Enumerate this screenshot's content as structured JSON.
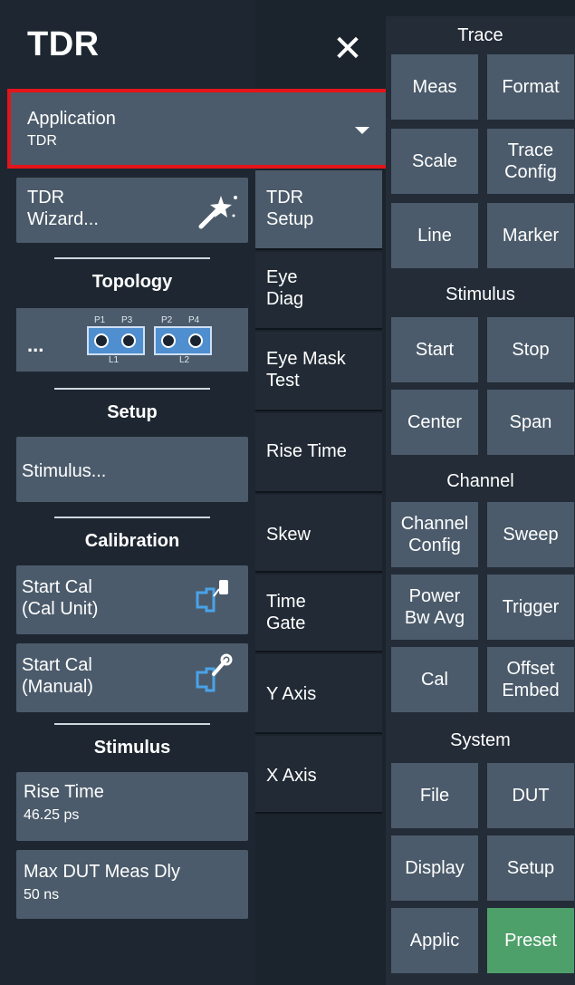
{
  "dialog": {
    "title": "TDR",
    "close_symbol": "✕"
  },
  "application": {
    "label": "Application",
    "value": "TDR"
  },
  "left": {
    "wizard": {
      "label_line1": "TDR",
      "label_line2": "Wizard..."
    },
    "topology": {
      "heading": "Topology",
      "button_text": "...",
      "ports": [
        "P1",
        "P3",
        "P2",
        "P4"
      ],
      "lines": [
        "L1",
        "L2"
      ]
    },
    "setup": {
      "heading": "Setup",
      "stimulus_button": "Stimulus..."
    },
    "calibration": {
      "heading": "Calibration",
      "start_cal_unit": {
        "line1": "Start Cal",
        "line2": "(Cal Unit)"
      },
      "start_cal_manual": {
        "line1": "Start Cal",
        "line2": "(Manual)"
      }
    },
    "stimulus": {
      "heading": "Stimulus",
      "rise_time": {
        "label": "Rise Time",
        "value": "46.25 ps"
      },
      "max_dut_meas_dly": {
        "label": "Max DUT Meas Dly",
        "value": "50 ns"
      }
    }
  },
  "tabs": [
    {
      "line1": "TDR",
      "line2": "Setup",
      "active": true
    },
    {
      "line1": "Eye",
      "line2": "Diag"
    },
    {
      "line1": "Eye Mask",
      "line2": "Test"
    },
    {
      "line1": "Rise Time",
      "line2": ""
    },
    {
      "line1": "Skew",
      "line2": ""
    },
    {
      "line1": "Time",
      "line2": "Gate"
    },
    {
      "line1": "Y Axis",
      "line2": ""
    },
    {
      "line1": "X Axis",
      "line2": ""
    }
  ],
  "right": {
    "trace": {
      "heading": "Trace",
      "buttons": [
        {
          "line1": "Meas"
        },
        {
          "line1": "Format"
        },
        {
          "line1": "Scale"
        },
        {
          "line1": "Trace",
          "line2": "Config"
        },
        {
          "line1": "Line"
        },
        {
          "line1": "Marker"
        }
      ]
    },
    "stimulus": {
      "heading": "Stimulus",
      "buttons": [
        {
          "line1": "Start"
        },
        {
          "line1": "Stop"
        },
        {
          "line1": "Center"
        },
        {
          "line1": "Span"
        }
      ]
    },
    "channel": {
      "heading": "Channel",
      "buttons": [
        {
          "line1": "Channel",
          "line2": "Config"
        },
        {
          "line1": "Sweep"
        },
        {
          "line1": "Power",
          "line2": "Bw Avg"
        },
        {
          "line1": "Trigger"
        },
        {
          "line1": "Cal"
        },
        {
          "line1": "Offset",
          "line2": "Embed"
        }
      ]
    },
    "system": {
      "heading": "System",
      "buttons": [
        {
          "line1": "File"
        },
        {
          "line1": "DUT"
        },
        {
          "line1": "Display"
        },
        {
          "line1": "Setup"
        },
        {
          "line1": "Applic"
        },
        {
          "line1": "Preset"
        }
      ]
    }
  },
  "colors": {
    "highlight_border": "#e4141a",
    "preset_green": "#4ea06a",
    "button": "#4b5b6b"
  }
}
